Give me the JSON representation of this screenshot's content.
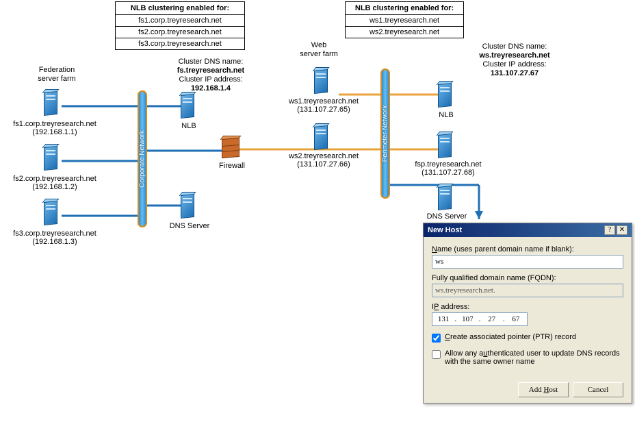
{
  "nlb_left": {
    "header": "NLB clustering enabled for:",
    "items": [
      "fs1.corp.treyresearch.net",
      "fs2.corp.treyresearch.net",
      "fs3.corp.treyresearch.net"
    ]
  },
  "nlb_right": {
    "header": "NLB clustering enabled for:",
    "items": [
      "ws1.treyresearch.net",
      "ws2.treyresearch.net"
    ]
  },
  "cluster_left": {
    "l1": "Cluster DNS name:",
    "l2": "fs.treyresearch.net",
    "l3": "Cluster IP address:",
    "l4": "192.168.1.4"
  },
  "cluster_right": {
    "l1": "Cluster DNS name:",
    "l2": "ws.treyresearch.net",
    "l3": "Cluster IP address:",
    "l4": "131.107.27.67"
  },
  "labels": {
    "fed_farm": "Federation\nserver farm",
    "web_farm": "Web\nserver farm",
    "corporate_network": "Corporate Network",
    "perimeter_network": "Perimeter Network",
    "firewall": "Firewall",
    "dns_server": "DNS Server",
    "nlb": "NLB"
  },
  "servers": {
    "fs1": {
      "name": "fs1.corp.treyresearch.net",
      "ip": "(192.168.1.1)"
    },
    "fs2": {
      "name": "fs2.corp.treyresearch.net",
      "ip": "(192.168.1.2)"
    },
    "fs3": {
      "name": "fs3.corp.treyresearch.net",
      "ip": "(192.168.1.3)"
    },
    "ws1": {
      "name": "ws1.treyresearch.net",
      "ip": "(131.107.27.65)"
    },
    "ws2": {
      "name": "ws2.treyresearch.net",
      "ip": "(131.107.27.66)"
    },
    "fsp": {
      "name": "fsp.treyresearch.net",
      "ip": "(131.107.27.68)"
    }
  },
  "dialog": {
    "title": "New Host",
    "name_label": "Name (uses parent domain name if blank):",
    "name_value": "ws",
    "fqdn_label": "Fully qualified domain name (FQDN):",
    "fqdn_value": "ws.treyresearch.net.",
    "ip_label": "IP address:",
    "ip": [
      "131",
      "107",
      "27",
      "67"
    ],
    "chk_ptr_label": "Create associated pointer (PTR) record",
    "chk_ptr_checked": true,
    "chk_allow_label": "Allow any authenticated user to update DNS records with the same owner name",
    "chk_allow_checked": false,
    "btn_add": "Add Host",
    "btn_cancel": "Cancel",
    "help_btn": "?",
    "close_btn": "✕"
  }
}
